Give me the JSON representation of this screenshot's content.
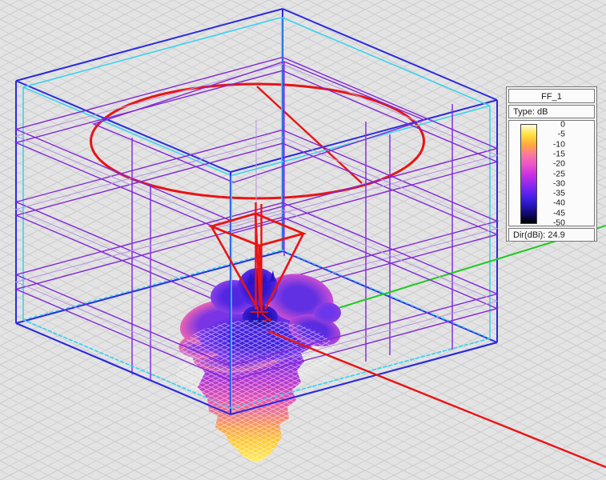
{
  "app": {
    "view_name": "farfield-3d-view"
  },
  "legend": {
    "title": "FF_1",
    "type_label": "Type: dB",
    "dir_label": "Dir(dBi): 24.9",
    "colorbar": {
      "unit": "dB",
      "stops": [
        {
          "label": "0",
          "color": "#fffce2"
        },
        {
          "label": "-5",
          "color": "#ffe23c"
        },
        {
          "label": "-10",
          "color": "#ffaa3c"
        },
        {
          "label": "-15",
          "color": "#fa7a9a"
        },
        {
          "label": "-20",
          "color": "#ee54c8"
        },
        {
          "label": "-25",
          "color": "#cc33e0"
        },
        {
          "label": "-30",
          "color": "#9429f0"
        },
        {
          "label": "-35",
          "color": "#5a22f0"
        },
        {
          "label": "-40",
          "color": "#2a18cc"
        },
        {
          "label": "-45",
          "color": "#120a6e"
        },
        {
          "label": "-50",
          "color": "#000000"
        }
      ]
    }
  },
  "scene": {
    "background_color": "#e3e3e4",
    "grid_color": "#d1d1d3",
    "grid_major_color": "#c6c6c8",
    "bounding_box_color": "#2a2ae0",
    "boundary_box_color": "#3cd2ee",
    "mesh_plane_color": "#8227d8",
    "mesh_plane_light_color": "#b695e0",
    "antenna_color": "#e81414",
    "farfield_circle_color": "#e81414",
    "axis_x_color": "#e81414",
    "axis_y_color": "#1fca1f",
    "pattern_mesh_color": "#ffffff",
    "pattern_gradient": [
      "#6228e6",
      "#8c2ee0",
      "#bc38cc",
      "#e052b2",
      "#ef7d80",
      "#f9a24e",
      "#fdc634",
      "#ffee58"
    ]
  }
}
